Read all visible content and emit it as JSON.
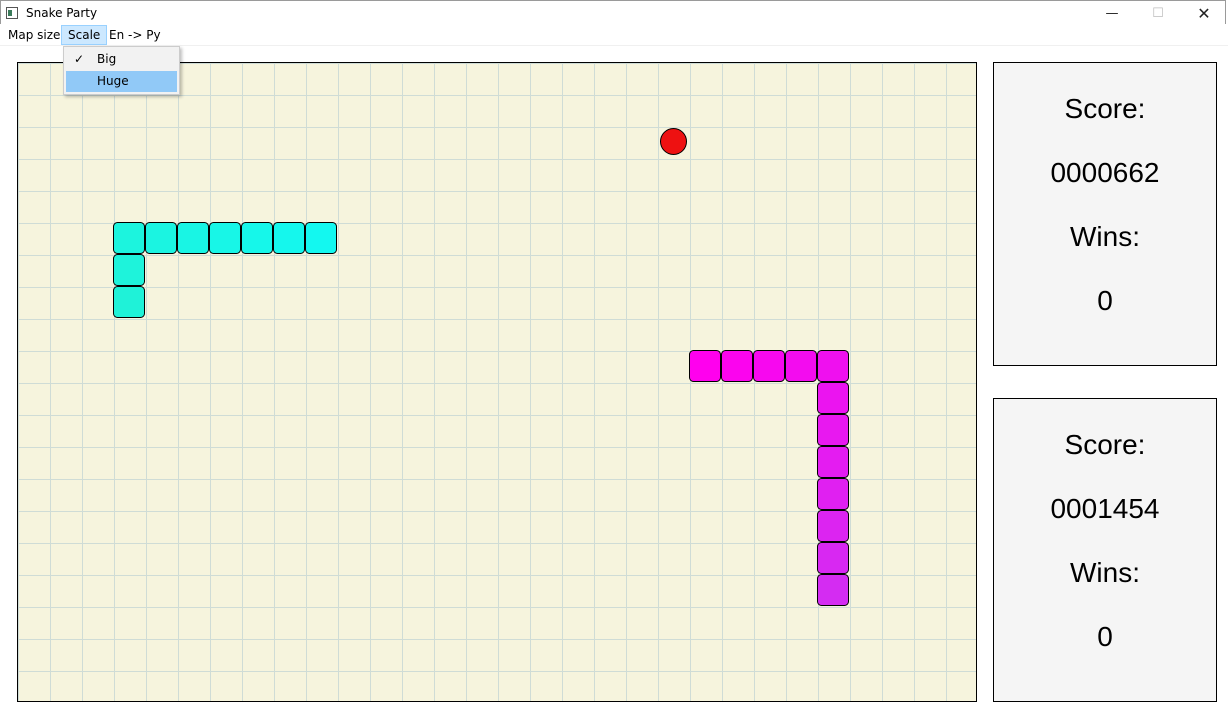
{
  "window": {
    "title": "Snake Party",
    "minimize": "—",
    "maximize": "☐",
    "close": "✕"
  },
  "menu": {
    "items": [
      "Map size",
      "Scale",
      "En -> Py"
    ],
    "active": "Scale",
    "dropdown": [
      {
        "label": "Big",
        "checked": true,
        "check_glyph": "✓"
      },
      {
        "label": "Huge",
        "checked": false,
        "highlighted": true
      }
    ]
  },
  "board": {
    "cols": 30,
    "rows": 20,
    "background": "#f6f4dd",
    "grid_color": "#cfdcd6",
    "food": {
      "cell": [
        20,
        2
      ],
      "color": "#ee1111"
    },
    "snakes": [
      {
        "color": "#13f8f0",
        "tail_color": "#1ff2d8",
        "cells": [
          [
            9,
            5
          ],
          [
            8,
            5
          ],
          [
            7,
            5
          ],
          [
            6,
            5
          ],
          [
            5,
            5
          ],
          [
            4,
            5
          ],
          [
            3,
            5
          ],
          [
            3,
            6
          ],
          [
            3,
            7
          ]
        ]
      },
      {
        "color": "#ff00ee",
        "tail_color": "#d42cf2",
        "cells": [
          [
            21,
            9
          ],
          [
            22,
            9
          ],
          [
            23,
            9
          ],
          [
            24,
            9
          ],
          [
            25,
            9
          ],
          [
            25,
            10
          ],
          [
            25,
            11
          ],
          [
            25,
            12
          ],
          [
            25,
            13
          ],
          [
            25,
            14
          ],
          [
            25,
            15
          ],
          [
            25,
            16
          ]
        ]
      }
    ]
  },
  "players": [
    {
      "score_label": "Score:",
      "score": "0000662",
      "wins_label": "Wins:",
      "wins": "0"
    },
    {
      "score_label": "Score:",
      "score": "0001454",
      "wins_label": "Wins:",
      "wins": "0"
    }
  ]
}
